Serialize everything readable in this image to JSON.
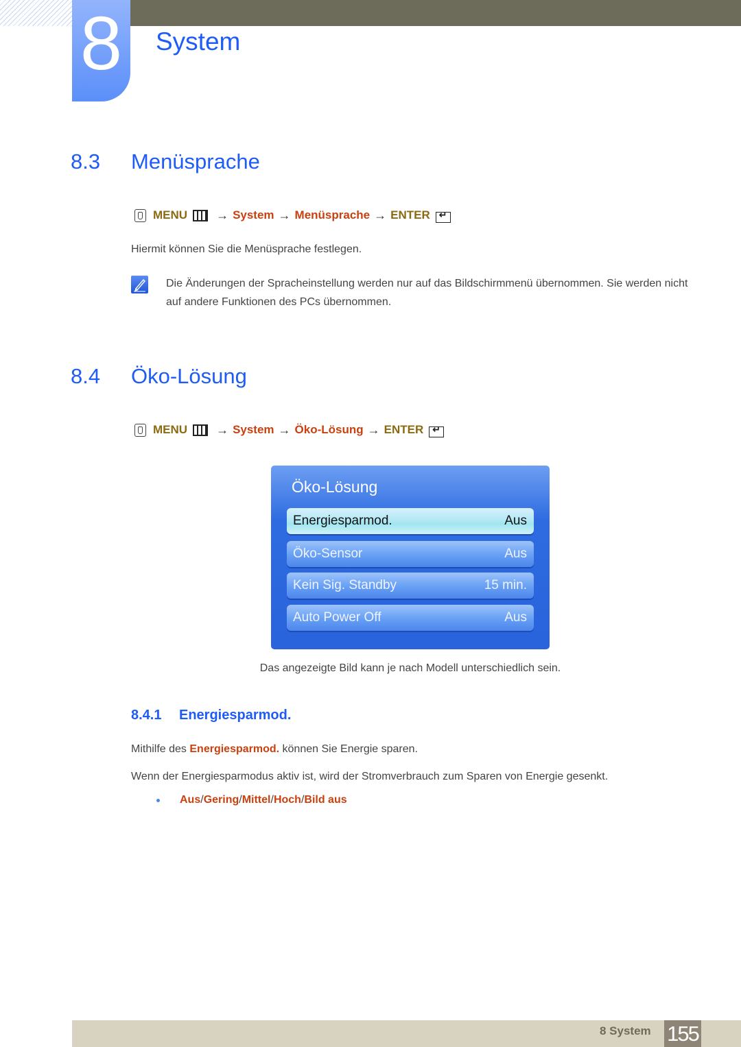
{
  "header": {
    "chapter_number": "8",
    "chapter_title": "System"
  },
  "section_8_3": {
    "number": "8.3",
    "title": "Menüsprache",
    "path": {
      "menu": "MENU",
      "arrow": "→",
      "step1": "System",
      "step2": "Menüsprache",
      "enter": "ENTER"
    },
    "description": "Hiermit können Sie die Menüsprache festlegen.",
    "note": "Die Änderungen der Spracheinstellung werden nur auf das Bildschirmmenü übernommen. Sie werden nicht auf andere Funktionen des PCs übernommen."
  },
  "section_8_4": {
    "number": "8.4",
    "title": "Öko-Lösung",
    "path": {
      "menu": "MENU",
      "arrow": "→",
      "step1": "System",
      "step2": "Öko-Lösung",
      "enter": "ENTER"
    },
    "osd": {
      "title": "Öko-Lösung",
      "items": [
        {
          "label": "Energiesparmod.",
          "value": "Aus",
          "selected": true
        },
        {
          "label": "Öko-Sensor",
          "value": "Aus",
          "selected": false
        },
        {
          "label": "Kein Sig. Standby",
          "value": "15 min.",
          "selected": false
        },
        {
          "label": "Auto Power Off",
          "value": "Aus",
          "selected": false
        }
      ]
    },
    "caption": "Das angezeigte Bild kann je nach Modell unterschiedlich sein."
  },
  "section_8_4_1": {
    "number": "8.4.1",
    "title": "Energiesparmod.",
    "para1_before": "Mithilfe des ",
    "para1_highlight": "Energiesparmod.",
    "para1_after": " können Sie Energie sparen.",
    "para2": "Wenn der Energiesparmodus aktiv ist, wird der Stromverbrauch zum Sparen von Energie gesenkt.",
    "options": [
      "Aus",
      "Gering",
      "Mittel",
      "Hoch",
      "Bild aus"
    ],
    "separator": "/"
  },
  "footer": {
    "label": "8 System",
    "page_number": "155"
  },
  "colors": {
    "heading_blue": "#1f5cf5",
    "highlight_orange": "#c8410f",
    "menu_gold": "#8b6a12",
    "top_bar": "#6d6b5a",
    "footer_bar": "#d8d3c0",
    "page_num_bg": "#8f8577"
  }
}
